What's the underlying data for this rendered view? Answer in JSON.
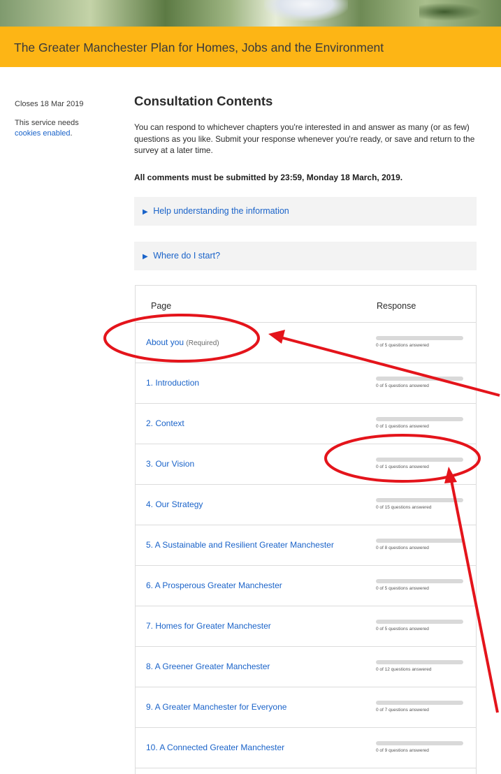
{
  "banner": {
    "title": "The Greater Manchester Plan for Homes, Jobs and the Environment"
  },
  "sidebar": {
    "closes": "Closes 18 Mar 2019",
    "cookies_prefix": "This service needs",
    "cookies_link": "cookies enabled",
    "cookies_suffix": "."
  },
  "main": {
    "heading": "Consultation Contents",
    "intro": "You can respond to whichever chapters you're interested in and answer as many (or as few) questions as you like. Submit your response whenever you're ready, or save and return to the survey at a later time.",
    "deadline": "All comments must be submitted by 23:59, Monday 18 March, 2019.",
    "details": [
      {
        "label": "Help understanding the information"
      },
      {
        "label": "Where do I start?"
      }
    ]
  },
  "table": {
    "col_page": "Page",
    "col_response": "Response",
    "rows": [
      {
        "label": "About you",
        "note": "(Required)",
        "progress": "0 of 5 questions answered",
        "fraction": 0
      },
      {
        "label": "1. Introduction",
        "note": "",
        "progress": "0 of 5 questions answered",
        "fraction": 0
      },
      {
        "label": "2. Context",
        "note": "",
        "progress": "0 of 1 questions answered",
        "fraction": 0
      },
      {
        "label": "3. Our Vision",
        "note": "",
        "progress": "0 of 1 questions answered",
        "fraction": 0
      },
      {
        "label": "4. Our Strategy",
        "note": "",
        "progress": "0 of 15 questions answered",
        "fraction": 0
      },
      {
        "label": "5. A Sustainable and Resilient Greater Manchester",
        "note": "",
        "progress": "0 of 8 questions answered",
        "fraction": 0
      },
      {
        "label": "6. A Prosperous Greater Manchester",
        "note": "",
        "progress": "0 of 5 questions answered",
        "fraction": 0
      },
      {
        "label": "7. Homes for Greater Manchester",
        "note": "",
        "progress": "0 of 5 questions answered",
        "fraction": 0
      },
      {
        "label": "8. A Greener Greater Manchester",
        "note": "",
        "progress": "0 of 12 questions answered",
        "fraction": 0
      },
      {
        "label": "9. A Greater Manchester for Everyone",
        "note": "",
        "progress": "0 of 7 questions answered",
        "fraction": 0
      },
      {
        "label": "10. A Connected Greater Manchester",
        "note": "",
        "progress": "0 of 9 questions answered",
        "fraction": 0
      }
    ]
  },
  "colors": {
    "banner": "#fdb515",
    "link": "#1a63c9",
    "annotation": "#e4141b"
  },
  "icons": {
    "details_toggle": "triangle-right-icon"
  }
}
